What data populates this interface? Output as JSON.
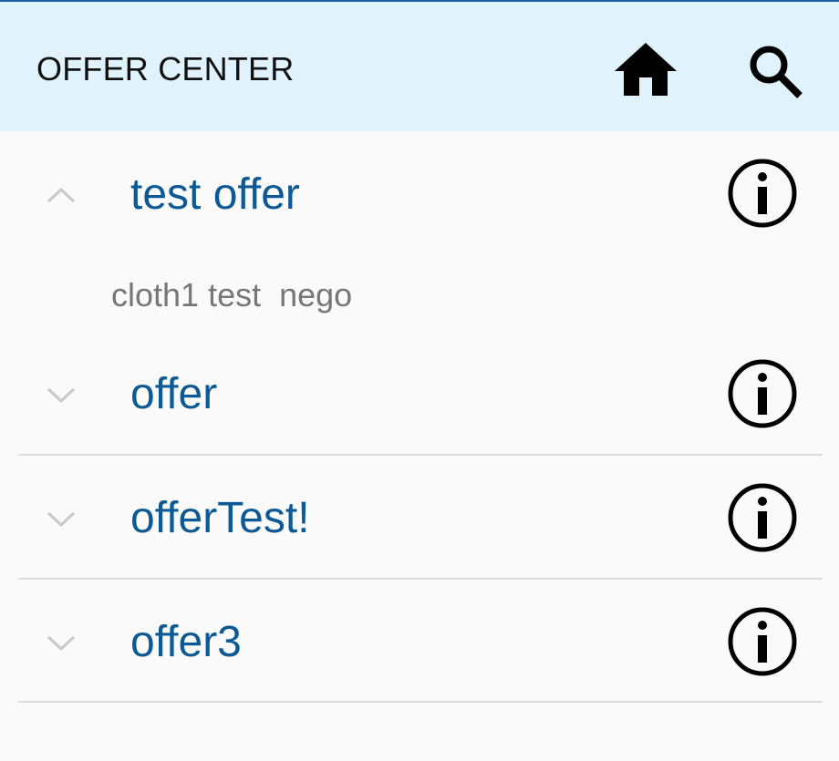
{
  "header": {
    "title": "OFFER CENTER",
    "icons": [
      "home-icon",
      "search-icon"
    ],
    "background": "#e0f3fd"
  },
  "offers": [
    {
      "title": "test offer",
      "expanded": true,
      "detail": "cloth1 test  nego"
    },
    {
      "title": "offer",
      "expanded": false
    },
    {
      "title": "offerTest!",
      "expanded": false
    },
    {
      "title": "offer3",
      "expanded": false
    }
  ],
  "colors": {
    "offer_title": "#0d5996",
    "detail_text": "#777777",
    "chevron": "#c8c8c8"
  }
}
